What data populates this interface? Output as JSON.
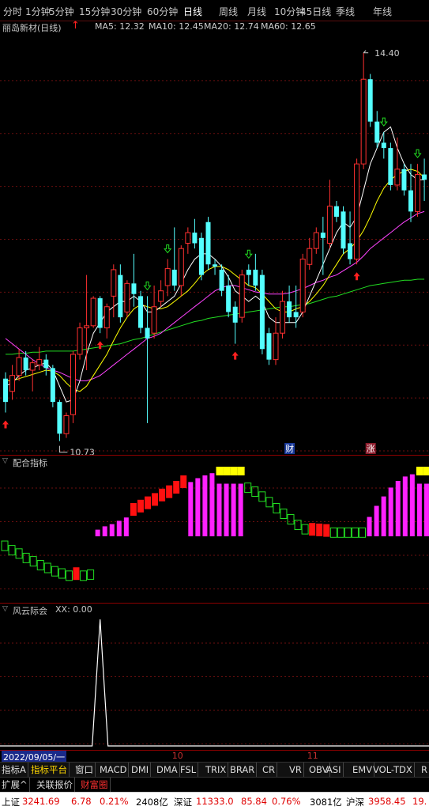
{
  "periods": [
    "分时",
    "1分钟",
    "5分钟",
    "15分钟",
    "30分钟",
    "60分钟",
    "日线",
    "周线",
    "月线",
    "10分钟",
    "45日线",
    "季线",
    "年线"
  ],
  "active_period": "日线",
  "stock": {
    "title": "丽岛新材(日线)"
  },
  "ma_legend": [
    {
      "label": "MA5: 12.32",
      "color": "#ffffff"
    },
    {
      "label": "MA10: 12.45",
      "color": "#ffff00"
    },
    {
      "label": "MA20: 12.74",
      "color": "#ff44ff"
    },
    {
      "label": "MA60: 12.65",
      "color": "#22dd22"
    }
  ],
  "main_chart": {
    "high_label": "14.40",
    "low_label": "10.73",
    "markers": [
      "财",
      "涨"
    ]
  },
  "chart_data": {
    "type": "candlestick",
    "ylim": [
      10.6,
      14.6
    ],
    "candles": [
      [
        11.32,
        11.1,
        11.38,
        11.0
      ],
      [
        11.2,
        11.35,
        11.45,
        11.12
      ],
      [
        11.35,
        11.52,
        11.6,
        11.3
      ],
      [
        11.52,
        11.4,
        11.58,
        11.35
      ],
      [
        11.4,
        11.47,
        11.5,
        11.2
      ],
      [
        11.45,
        11.5,
        11.62,
        11.4
      ],
      [
        11.5,
        11.42,
        11.55,
        11.35
      ],
      [
        11.42,
        11.1,
        11.45,
        11.05
      ],
      [
        11.1,
        10.8,
        11.12,
        10.73
      ],
      [
        10.8,
        10.97,
        11.0,
        10.76
      ],
      [
        10.98,
        11.55,
        11.58,
        10.9
      ],
      [
        11.55,
        11.8,
        11.85,
        11.5
      ],
      [
        11.8,
        11.82,
        12.3,
        11.4
      ],
      [
        11.82,
        12.08,
        12.1,
        11.8
      ],
      [
        12.08,
        11.8,
        12.1,
        11.75
      ],
      [
        11.8,
        12.0,
        12.03,
        11.7
      ],
      [
        12.1,
        12.35,
        12.4,
        11.9
      ],
      [
        12.3,
        11.9,
        12.4,
        11.85
      ],
      [
        11.95,
        12.22,
        12.25,
        11.9
      ],
      [
        12.22,
        12.12,
        12.5,
        12.0
      ],
      [
        12.1,
        11.8,
        12.15,
        11.75
      ],
      [
        11.8,
        11.7,
        12.1,
        10.9
      ],
      [
        11.75,
        12.0,
        12.2,
        11.7
      ],
      [
        12.05,
        12.15,
        12.25,
        12.0
      ],
      [
        12.2,
        12.36,
        12.45,
        12.1
      ],
      [
        12.35,
        12.2,
        12.75,
        12.15
      ],
      [
        12.2,
        12.55,
        12.58,
        12.1
      ],
      [
        12.6,
        12.7,
        12.75,
        12.5
      ],
      [
        12.7,
        12.6,
        12.83,
        12.55
      ],
      [
        12.65,
        12.3,
        12.7,
        12.25
      ],
      [
        12.8,
        12.4,
        12.85,
        12.35
      ],
      [
        12.4,
        12.38,
        12.45,
        12.3
      ],
      [
        12.35,
        12.15,
        12.4,
        12.1
      ],
      [
        12.2,
        11.95,
        12.3,
        11.9
      ],
      [
        12.0,
        11.85,
        12.05,
        11.65
      ],
      [
        11.9,
        12.3,
        12.35,
        11.85
      ],
      [
        12.35,
        12.3,
        12.4,
        12.2
      ],
      [
        12.35,
        12.2,
        12.5,
        12.15
      ],
      [
        12.3,
        11.6,
        12.35,
        11.55
      ],
      [
        11.75,
        11.5,
        11.8,
        11.45
      ],
      [
        11.5,
        11.75,
        11.9,
        11.45
      ],
      [
        11.75,
        12.05,
        12.15,
        11.7
      ],
      [
        12.05,
        11.9,
        12.2,
        11.85
      ],
      [
        11.95,
        11.9,
        12.2,
        11.8
      ],
      [
        11.95,
        12.45,
        12.5,
        11.9
      ],
      [
        12.4,
        12.55,
        12.65,
        12.35
      ],
      [
        12.55,
        12.7,
        12.75,
        12.5
      ],
      [
        12.7,
        12.65,
        12.85,
        12.3
      ],
      [
        12.6,
        12.95,
        13.2,
        12.55
      ],
      [
        12.95,
        12.85,
        13.0,
        12.8
      ],
      [
        12.9,
        12.55,
        12.95,
        12.5
      ],
      [
        12.6,
        12.45,
        12.9,
        12.4
      ],
      [
        12.45,
        13.35,
        13.4,
        12.4
      ],
      [
        13.35,
        14.15,
        14.4,
        13.3
      ],
      [
        14.15,
        13.75,
        14.2,
        13.7
      ],
      [
        13.75,
        13.55,
        13.85,
        13.5
      ],
      [
        13.55,
        13.5,
        13.65,
        13.4
      ],
      [
        13.5,
        13.15,
        13.55,
        13.1
      ],
      [
        13.15,
        13.3,
        13.6,
        13.1
      ],
      [
        13.3,
        13.1,
        13.35,
        13.05
      ],
      [
        13.1,
        12.9,
        13.35,
        12.8
      ],
      [
        12.9,
        13.25,
        13.35,
        12.85
      ],
      [
        13.25,
        13.2,
        13.4,
        13.0
      ]
    ],
    "ma5": [
      11.25,
      11.28,
      11.35,
      11.4,
      11.42,
      11.45,
      11.47,
      11.4,
      11.25,
      11.1,
      11.12,
      11.3,
      11.55,
      11.75,
      11.85,
      11.95,
      12.0,
      12.05,
      12.05,
      12.1,
      12.05,
      11.95,
      11.95,
      12.0,
      12.05,
      12.1,
      12.22,
      12.35,
      12.45,
      12.5,
      12.5,
      12.45,
      12.38,
      12.28,
      12.15,
      12.1,
      12.05,
      12.1,
      12.05,
      11.9,
      11.85,
      11.85,
      11.85,
      11.85,
      11.95,
      12.1,
      12.25,
      12.4,
      12.55,
      12.7,
      12.8,
      12.75,
      12.85,
      13.1,
      13.35,
      13.5,
      13.65,
      13.7,
      13.5,
      13.35,
      13.25,
      13.2,
      13.2
    ],
    "ma10": [
      11.3,
      11.3,
      11.32,
      11.34,
      11.36,
      11.38,
      11.4,
      11.39,
      11.35,
      11.28,
      11.22,
      11.2,
      11.25,
      11.35,
      11.45,
      11.55,
      11.68,
      11.8,
      11.9,
      11.98,
      12.02,
      12.0,
      11.98,
      11.98,
      12.0,
      12.05,
      12.1,
      12.15,
      12.22,
      12.3,
      12.35,
      12.38,
      12.38,
      12.35,
      12.3,
      12.25,
      12.2,
      12.18,
      12.12,
      12.05,
      11.98,
      11.95,
      11.95,
      11.98,
      12.0,
      12.05,
      12.12,
      12.2,
      12.3,
      12.4,
      12.5,
      12.55,
      12.62,
      12.72,
      12.85,
      13.0,
      13.12,
      13.2,
      13.25,
      13.28,
      13.3,
      13.28,
      13.22
    ],
    "ma20": [
      11.7,
      11.65,
      11.6,
      11.55,
      11.5,
      11.46,
      11.42,
      11.4,
      11.38,
      11.35,
      11.32,
      11.3,
      11.3,
      11.32,
      11.35,
      11.4,
      11.45,
      11.5,
      11.55,
      11.6,
      11.65,
      11.7,
      11.72,
      11.75,
      11.8,
      11.85,
      11.9,
      11.95,
      12.0,
      12.05,
      12.1,
      12.15,
      12.18,
      12.2,
      12.2,
      12.18,
      12.16,
      12.14,
      12.13,
      12.12,
      12.12,
      12.12,
      12.13,
      12.15,
      12.17,
      12.2,
      12.23,
      12.25,
      12.28,
      12.3,
      12.34,
      12.38,
      12.42,
      12.48,
      12.55,
      12.6,
      12.65,
      12.7,
      12.75,
      12.8,
      12.84,
      12.88,
      12.9
    ],
    "ma60": [
      11.55,
      11.55,
      11.56,
      11.56,
      11.57,
      11.57,
      11.58,
      11.58,
      11.58,
      11.58,
      11.58,
      11.59,
      11.6,
      11.61,
      11.62,
      11.63,
      11.64,
      11.65,
      11.67,
      11.69,
      11.7,
      11.72,
      11.74,
      11.76,
      11.78,
      11.8,
      11.82,
      11.84,
      11.86,
      11.87,
      11.89,
      11.9,
      11.91,
      11.92,
      11.93,
      11.94,
      11.95,
      11.96,
      11.97,
      11.98,
      11.99,
      12.0,
      12.0,
      12.01,
      12.02,
      12.03,
      12.05,
      12.07,
      12.09,
      12.1,
      12.12,
      12.14,
      12.16,
      12.18,
      12.2,
      12.21,
      12.22,
      12.23,
      12.24,
      12.25,
      12.25,
      12.26,
      12.26
    ],
    "buy_signals": [
      0,
      14,
      34,
      52
    ],
    "sell_signals": [
      21,
      24,
      36,
      56,
      61
    ]
  },
  "panel2": {
    "title": "配合指标",
    "bars": [
      {
        "t": "g",
        "v": -0.2
      },
      {
        "t": "g",
        "v": -0.28
      },
      {
        "t": "g",
        "v": -0.34
      },
      {
        "t": "g",
        "v": -0.42
      },
      {
        "t": "g",
        "v": -0.48
      },
      {
        "t": "g",
        "v": -0.55
      },
      {
        "t": "g",
        "v": -0.6
      },
      {
        "t": "g",
        "v": -0.66
      },
      {
        "t": "g",
        "v": -0.7
      },
      {
        "t": "g",
        "v": -0.74
      },
      {
        "t": "r",
        "v": -0.76
      },
      {
        "t": "g",
        "v": -0.74
      },
      {
        "t": "g",
        "v": -0.72
      },
      {
        "t": "m",
        "v": 0.12
      },
      {
        "t": "m",
        "v": 0.18
      },
      {
        "t": "m",
        "v": 0.22
      },
      {
        "t": "m",
        "v": 0.28
      },
      {
        "t": "m",
        "v": 0.34
      },
      {
        "t": "r",
        "v": 0.4
      },
      {
        "t": "r",
        "v": 0.46
      },
      {
        "t": "r",
        "v": 0.52
      },
      {
        "t": "r",
        "v": 0.58
      },
      {
        "t": "r",
        "v": 0.66
      },
      {
        "t": "r",
        "v": 0.72
      },
      {
        "t": "r",
        "v": 0.8
      },
      {
        "t": "r",
        "v": 0.9
      },
      {
        "t": "m",
        "v": 0.98
      },
      {
        "t": "m",
        "v": 1.05
      },
      {
        "t": "m",
        "v": 1.1
      },
      {
        "t": "m",
        "v": 1.14
      },
      {
        "t": "y",
        "v": 1.0
      },
      {
        "t": "y",
        "v": 1.0
      },
      {
        "t": "y",
        "v": 1.0
      },
      {
        "t": "y",
        "v": 1.0
      },
      {
        "t": "g",
        "v": 0.82
      },
      {
        "t": "g",
        "v": 0.75
      },
      {
        "t": "g",
        "v": 0.66
      },
      {
        "t": "g",
        "v": 0.56
      },
      {
        "t": "g",
        "v": 0.45
      },
      {
        "t": "g",
        "v": 0.35
      },
      {
        "t": "g",
        "v": 0.25
      },
      {
        "t": "g",
        "v": 0.15
      },
      {
        "t": "g",
        "v": 0.07
      },
      {
        "t": "r",
        "v": 0.04
      },
      {
        "t": "r",
        "v": 0.03
      },
      {
        "t": "r",
        "v": 0.02
      },
      {
        "t": "g",
        "v": 0.01
      },
      {
        "t": "g",
        "v": 0.01
      },
      {
        "t": "g",
        "v": 0.01
      },
      {
        "t": "g",
        "v": 0.01
      },
      {
        "t": "g",
        "v": 0.01
      },
      {
        "t": "m",
        "v": 0.35
      },
      {
        "t": "m",
        "v": 0.55
      },
      {
        "t": "m",
        "v": 0.72
      },
      {
        "t": "m",
        "v": 0.88
      },
      {
        "t": "m",
        "v": 1.0
      },
      {
        "t": "m",
        "v": 1.08
      },
      {
        "t": "m",
        "v": 1.12
      },
      {
        "t": "y",
        "v": 1.15
      },
      {
        "t": "y",
        "v": 1.15
      }
    ]
  },
  "panel3": {
    "title": "风云际会",
    "xx_label": "XX: 0.00",
    "spike_index": 14
  },
  "x_axis": {
    "start_date": "2022/09/05/一",
    "month_labels": [
      {
        "label": "10",
        "i": 25
      },
      {
        "label": "11",
        "i": 45
      }
    ]
  },
  "indicator_tabs": [
    "指标A",
    "指标平台",
    "窗口",
    "MACD",
    "DMI",
    "DMA",
    "FSL",
    "TRIX",
    "BRAR",
    "CR",
    "VR",
    "OBV",
    "ASI",
    "EMV",
    "VOL-TDX",
    "R"
  ],
  "active_indicator_tab": "指标平台",
  "sub_tabs": [
    "扩展^",
    "关联报价",
    "财富圈"
  ],
  "status": {
    "sh_label": "上证",
    "sh_value": "3241.69",
    "sh_change": "6.78",
    "sh_pct": "0.21%",
    "sh_amount": "2408亿",
    "sz_label": "深证",
    "sz_value": "11333.0",
    "sz_change": "85.84",
    "sz_pct": "0.76%",
    "sz_amount": "3081亿",
    "hs_label": "沪深",
    "hs_value": "3958.45",
    "hs_change": "19."
  }
}
